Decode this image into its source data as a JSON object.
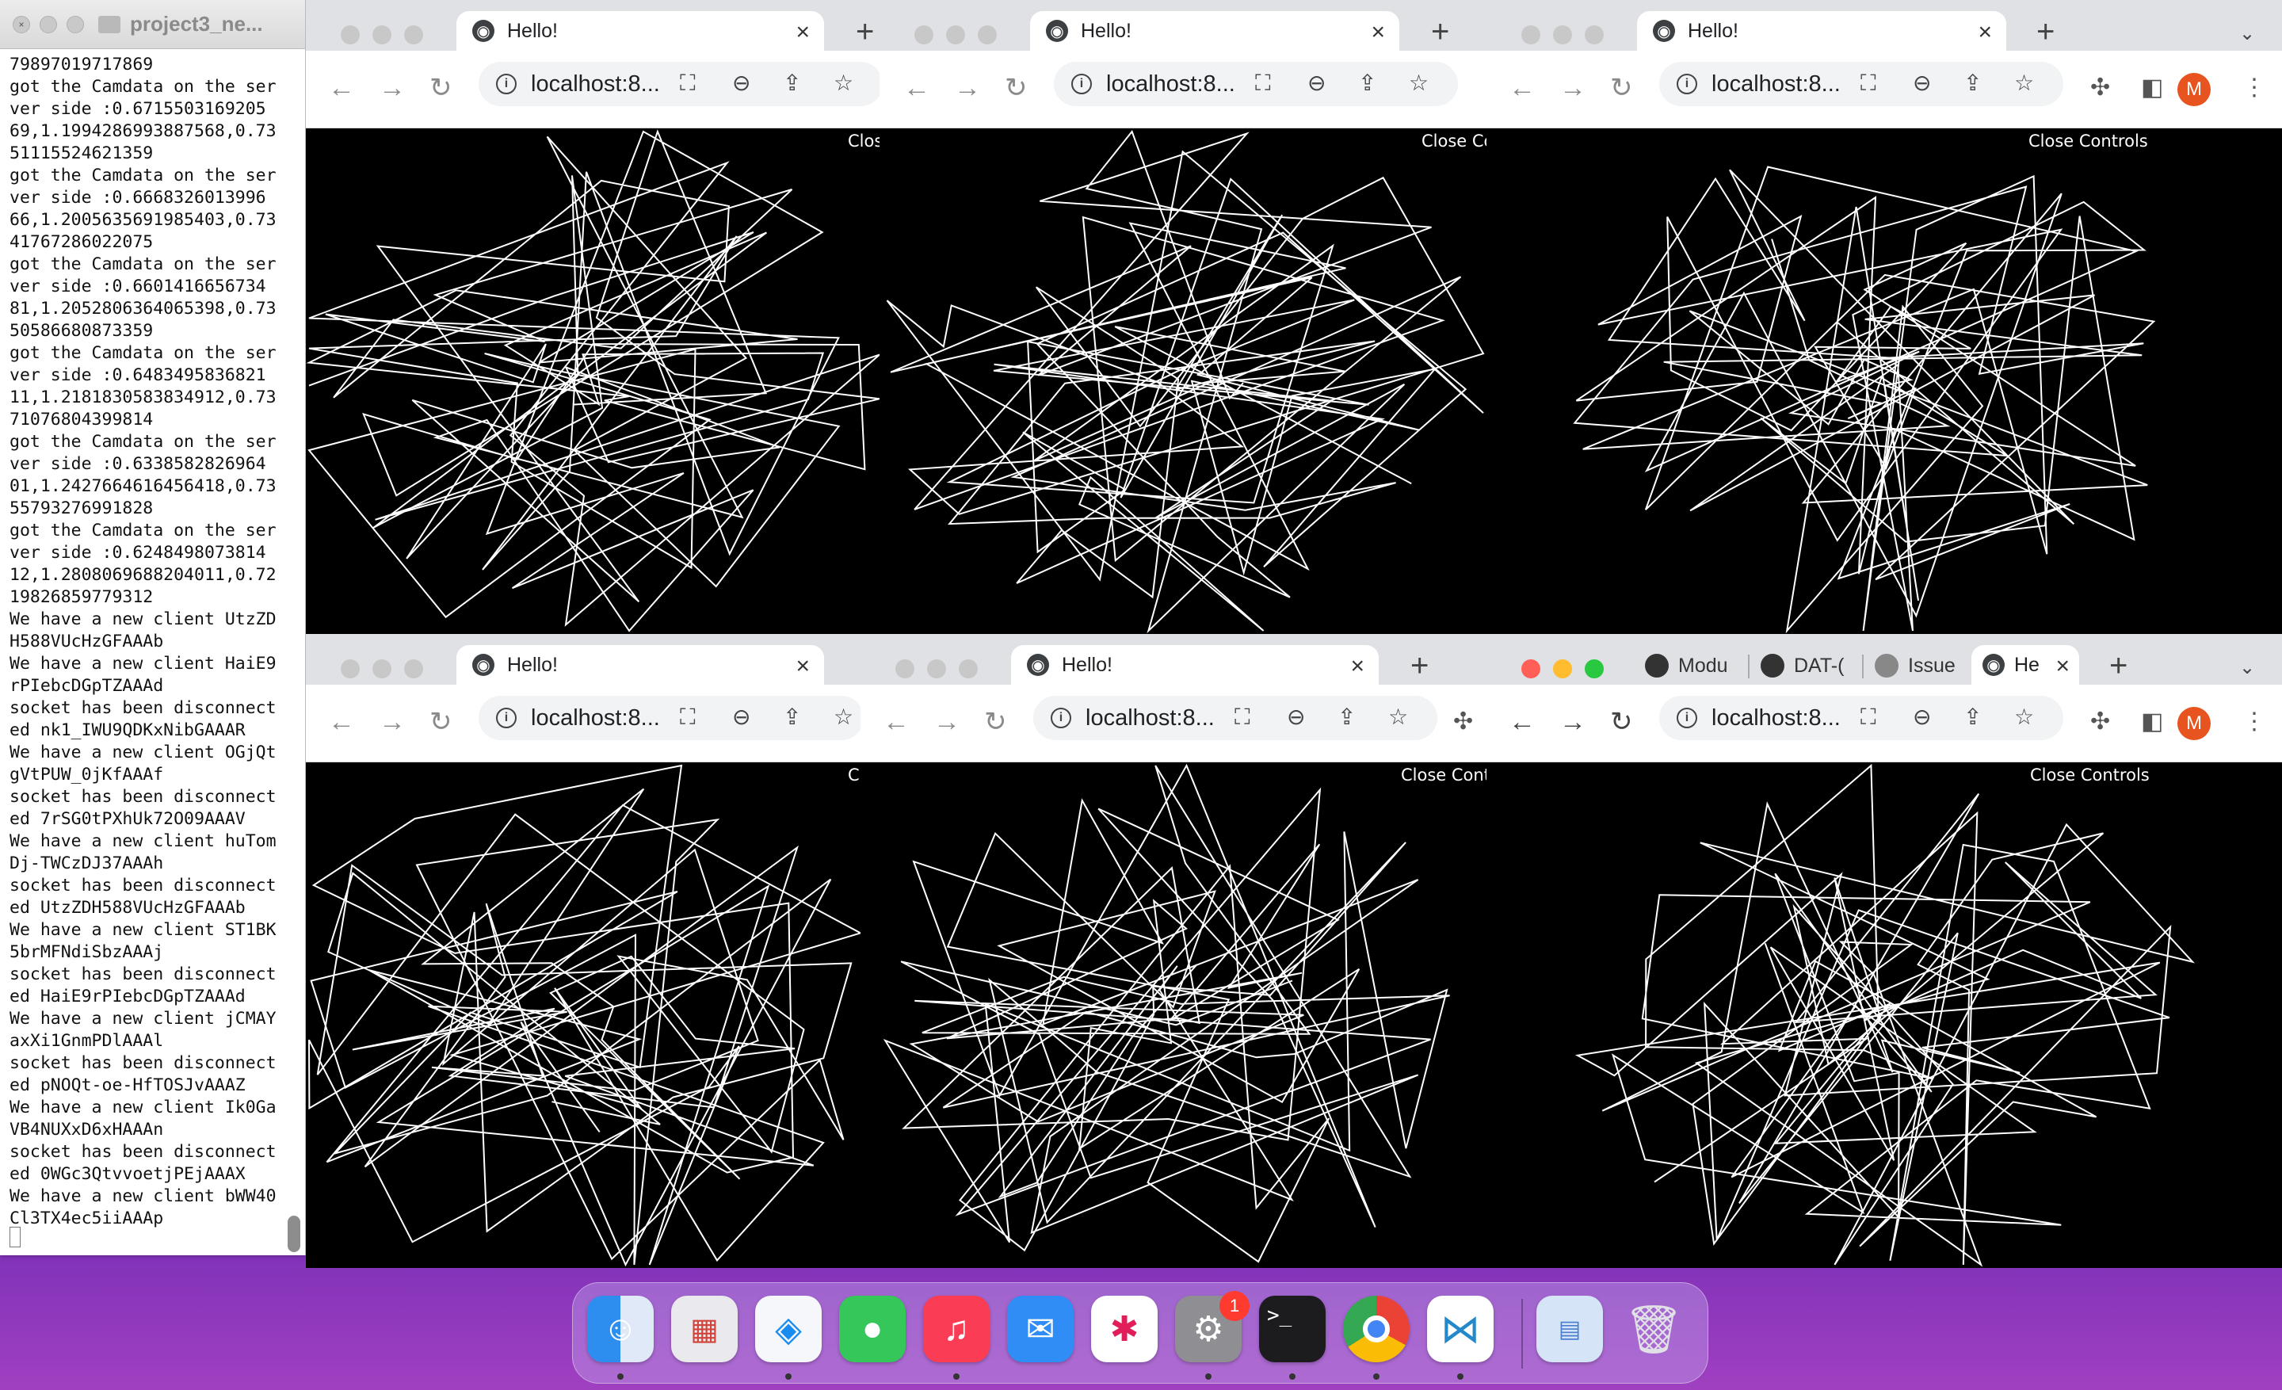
{
  "terminal": {
    "title": "project3_ne...",
    "close_glyph": "×",
    "lines": [
      "79897019717869",
      "got the Camdata on the ser",
      "ver side :0.6715503169205",
      "69,1.1994286993887568,0.73",
      "51115524621359",
      "got the Camdata on the ser",
      "ver side :0.6668326013996",
      "66,1.2005635691985403,0.73",
      "41767286022075",
      "got the Camdata on the ser",
      "ver side :0.6601416656734",
      "81,1.2052806364065398,0.73",
      "50586680873359",
      "got the Camdata on the ser",
      "ver side :0.6483495836821",
      "11,1.2181830583834912,0.73",
      "71076804399814",
      "got the Camdata on the ser",
      "ver side :0.6338582826964",
      "01,1.2427664616456418,0.73",
      "55793276991828",
      "got the Camdata on the ser",
      "ver side :0.6248498073814",
      "12,1.2808069688204011,0.72",
      "19826859779312",
      "We have a new client UtzZD",
      "H588VUcHzGFAAAb",
      "We have a new client HaiE9",
      "rPIebcDGpTZAAAd",
      "socket has been disconnect",
      "ed nk1_IWU9QDKxNibGAAAR",
      "We have a new client OGjQt",
      "gVtPUW_0jKfAAAf",
      "socket has been disconnect",
      "ed 7rSG0tPXhUk72O09AAAV",
      "We have a new client huTom",
      "Dj-TWCzDJ37AAAh",
      "socket has been disconnect",
      "ed UtzZDH588VUcHzGFAAAb",
      "We have a new client ST1BK",
      "5brMFNdiSbzAAAj",
      "socket has been disconnect",
      "ed HaiE9rPIebcDGpTZAAAd",
      "We have a new client jCMAY",
      "axXi1GnmPDlAAAl",
      "socket has been disconnect",
      "ed pNOQt-oe-HfTOSJvAAAZ",
      "We have a new client Ik0Ga",
      "VB4NUXxD6xHAAAn",
      "socket has been disconnect",
      "ed 0WGc3QtvvoetjPEjAAAX",
      "We have a new client bWW40",
      "Cl3TX4ec5iiAAAp"
    ]
  },
  "windows": [
    {
      "tab_title": "Hello!",
      "url": "localhost:8...",
      "close_controls": "Clos"
    },
    {
      "tab_title": "Hello!",
      "url": "localhost:8...",
      "close_controls": "Close Co"
    },
    {
      "tab_title": "Hello!",
      "url": "localhost:8...",
      "close_controls": "Close Controls"
    },
    {
      "tab_title": "Hello!",
      "url": "localhost:8...",
      "close_controls": "C"
    },
    {
      "tab_title": "Hello!",
      "url": "localhost:8...",
      "close_controls": "Close Contr"
    },
    {
      "tab_title": "He",
      "url": "localhost:8...",
      "close_controls": "Close Controls",
      "extra_tabs": [
        "Modu",
        "DAT-(",
        "Issue"
      ]
    }
  ],
  "browser": {
    "avatar_letter": "M",
    "new_tab_glyph": "+",
    "tab_close_glyph": "×",
    "back_glyph": "←",
    "forward_glyph": "→",
    "reload_glyph": "↻",
    "menu_glyph": "⋮",
    "dropdown_glyph": "⌄"
  },
  "dock": {
    "apps": [
      "Finder",
      "Launchpad",
      "Safari",
      "Messages",
      "Music",
      "Mail",
      "Slack",
      "System Preferences",
      "Terminal",
      "Chrome",
      "Visual Studio Code",
      "Downloads",
      "Trash"
    ],
    "system_prefs_badge": "1",
    "terminal_glyph": ">_",
    "colors": {
      "finder": "#2e8ef0",
      "launchpad": "#e9e9ee",
      "safari": "#1a8cf0",
      "messages": "#35c759",
      "music": "#fa3c55",
      "mail": "#2f8df5",
      "slack": "#ffffff",
      "sysprefs": "#8e8e93",
      "terminal": "#1c1c1e",
      "chrome": "#ffffff",
      "vscode": "#ffffff",
      "downloads": "#d6e4f7",
      "trash": "#e9e9ee"
    }
  }
}
